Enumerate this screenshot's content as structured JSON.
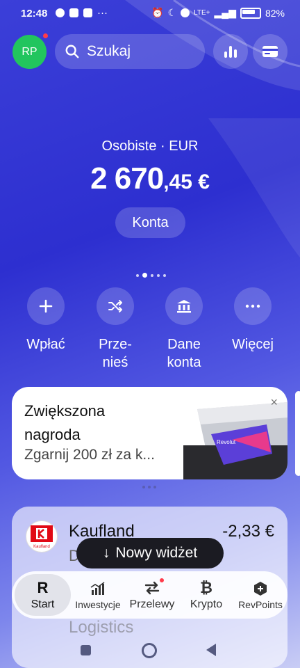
{
  "status_bar": {
    "time": "12:48",
    "battery": "82%",
    "network": "LTE+"
  },
  "header": {
    "avatar_initials": "RP",
    "search_placeholder": "Szukaj"
  },
  "account": {
    "label": "Osobiste · EUR",
    "balance_main": "2 670",
    "balance_decimal": ",45 €",
    "accounts_button": "Konta"
  },
  "actions": [
    {
      "label": "Wpłać",
      "icon": "plus-icon"
    },
    {
      "label": "Prze-\nnieś",
      "icon": "shuffle-icon"
    },
    {
      "label": "Dane\nkonta",
      "icon": "bank-icon"
    },
    {
      "label": "Więcej",
      "icon": "more-icon"
    }
  ],
  "promo": {
    "title_line1": "Zwiększona",
    "title_line2": "nagroda",
    "subtitle": "Zgarnij 200 zł za k...",
    "close": "×",
    "card_brand": "Revolut"
  },
  "transactions": {
    "items": [
      {
        "merchant": "Kaufland",
        "amount": "-2,33 €",
        "date": "D",
        "logo_text": "Kaufland"
      },
      {
        "merchant": "Logistics"
      }
    ]
  },
  "toast": {
    "arrow": "↓",
    "label": "Nowy widżet"
  },
  "bottom_nav": {
    "items": [
      {
        "label": "Start",
        "icon": "revolut-r-icon"
      },
      {
        "label": "Inwestycje",
        "icon": "investments-chart-icon"
      },
      {
        "label": "Przelewy",
        "icon": "transfer-arrows-icon"
      },
      {
        "label": "Krypto",
        "icon": "bitcoin-icon"
      },
      {
        "label": "RevPoints",
        "icon": "revpoints-icon"
      }
    ]
  },
  "colors": {
    "background": "#2d2fd0",
    "avatar": "#22c55e",
    "badge": "#ff3b4a",
    "kaufland_red": "#e10915"
  }
}
